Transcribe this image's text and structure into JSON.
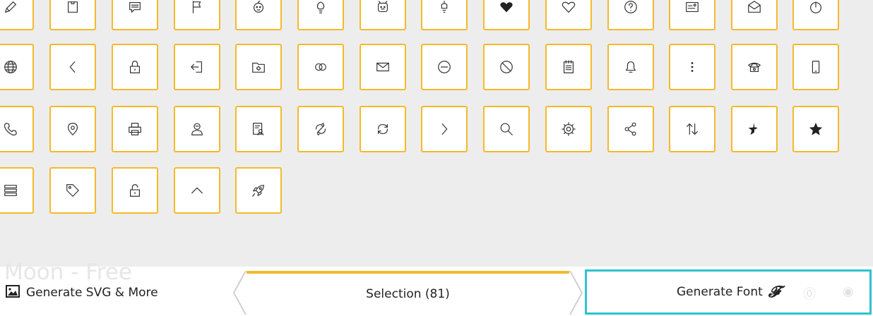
{
  "app": {
    "ghost_title": "Moon - Free"
  },
  "icon_grid": {
    "rows": [
      [
        "pencil-icon",
        "square-icon",
        "chat-icon",
        "flag-icon",
        "baby-icon",
        "lightbulb-icon",
        "face-icon",
        "idea-icon",
        "heart-filled-icon",
        "heart-icon",
        "help-icon",
        "card-icon",
        "mail-open-icon",
        "power-icon"
      ],
      [
        "globe-icon",
        "chevron-left-icon",
        "lock-icon",
        "sign-in-icon",
        "safe-folder-icon",
        "rings-icon",
        "mail-icon",
        "minus-circle-icon",
        "ban-icon",
        "notepad-icon",
        "bell-icon",
        "more-vertical-icon",
        "phone-classic-icon",
        "mobile-icon"
      ],
      [
        "phone-icon",
        "location-pin-icon",
        "printer-icon",
        "user-profile-icon",
        "id-card-icon",
        "sync-icon",
        "refresh-icon",
        "chevron-right-icon",
        "search-icon",
        "gear-icon",
        "share-icon",
        "sort-icon",
        "star-half-icon",
        "star-icon"
      ],
      [
        "list-icon",
        "tag-icon",
        "unlock-icon",
        "chevron-up-icon",
        "rocket-icon"
      ]
    ]
  },
  "bottom_bar": {
    "generate_svg_label": "Generate SVG & More",
    "selection_label": "Selection (81)",
    "generate_font_label": "Generate Font",
    "font_glyph": "𝓕"
  },
  "colors": {
    "accent": "#f5b92b",
    "highlight": "#30c2cf"
  }
}
